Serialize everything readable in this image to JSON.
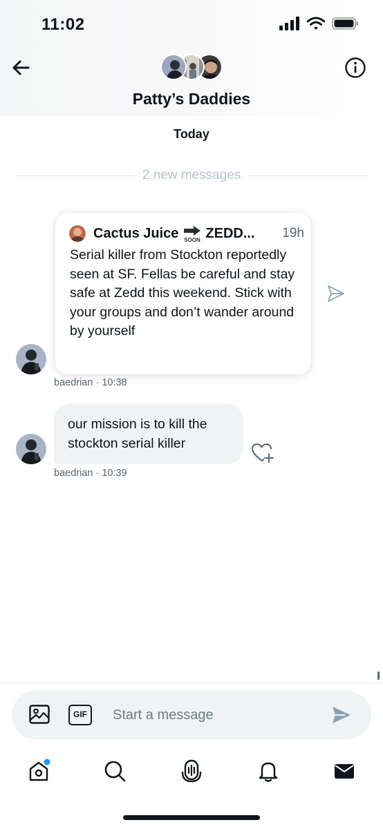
{
  "status_bar": {
    "time": "11:02"
  },
  "header": {
    "title": "Patty’s Daddies",
    "icons": {
      "back": "arrow-left-icon",
      "info": "info-icon"
    }
  },
  "conversation": {
    "date_label": "Today",
    "new_messages_label": "2 new messages",
    "shared_post": {
      "author": "Cactus Juice",
      "author_suffix": "ZEDD...",
      "emoji_label": "SOON",
      "time": "19h",
      "text": "Serial killer from Stockton reportedly seen at SF. Fellas be careful and stay safe at Zedd this weekend. Stick with your groups and don’t wander around by yourself",
      "sender_meta": "baedrian · 10:38"
    },
    "message": {
      "text": "our mission is to kill the stockton serial killer",
      "sender_meta": "baedrian · 10:39"
    }
  },
  "composer": {
    "placeholder": "Start a message",
    "gif_label": "GIF"
  },
  "tabbar": {
    "items": [
      "home-icon",
      "search-icon",
      "spaces-icon",
      "notifications-icon",
      "messages-icon"
    ],
    "home_has_badge": true
  },
  "colors": {
    "accent": "#1d9bf0",
    "muted": "#536471",
    "divider_text": "#b6c2cc",
    "bubble": "#eff3f4"
  }
}
